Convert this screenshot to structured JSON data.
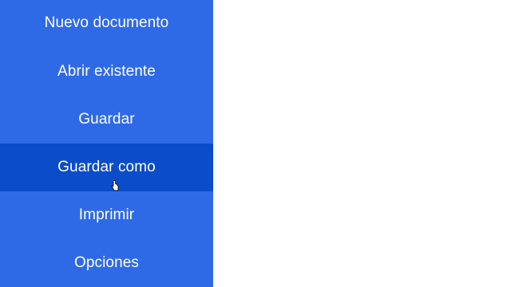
{
  "menu": {
    "items": [
      {
        "label": "Nuevo documento"
      },
      {
        "label": "Abrir existente"
      },
      {
        "label": "Guardar"
      },
      {
        "label": "Guardar como",
        "selected": true
      },
      {
        "label": "Imprimir"
      },
      {
        "label": "Opciones"
      }
    ]
  },
  "colors": {
    "menu_background": "#2f6ae6",
    "menu_selected": "#0a4cc9",
    "menu_text": "#ffffff",
    "content_background": "#ffffff"
  },
  "icons": {
    "cursor": "hand-pointer-icon"
  }
}
